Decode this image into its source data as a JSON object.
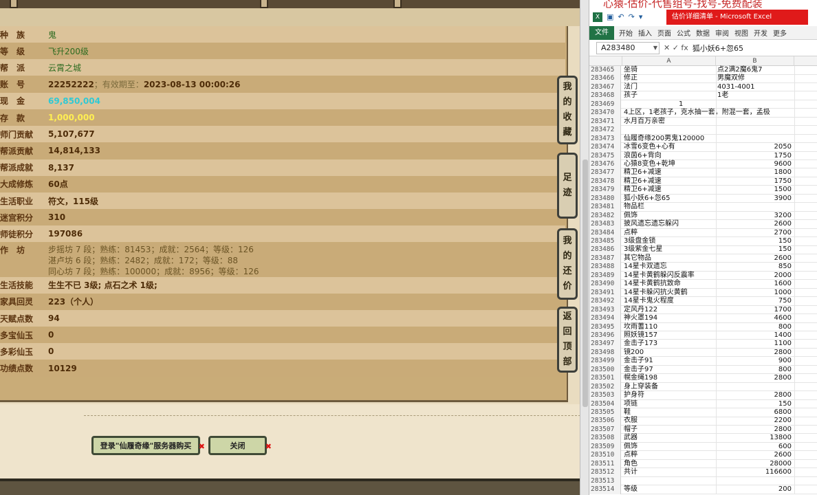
{
  "game": {
    "rows": [
      {
        "label": "种　族",
        "value": "鬼",
        "style": "green"
      },
      {
        "label": "等　级",
        "value": "飞升200级",
        "style": "green"
      },
      {
        "label": "帮　派",
        "value": "云霄之城",
        "style": "green"
      },
      {
        "label": "账　号",
        "value": "22252222",
        "sub": "；有效期至：",
        "value2": "2023-08-13 00:00:26",
        "style": "dark"
      },
      {
        "label": "现　金",
        "value": "69,850,004",
        "style": "cyan"
      },
      {
        "label": "存　款",
        "value": "1,000,000",
        "style": "yellow"
      },
      {
        "label": "师门贡献",
        "value": "5,107,677",
        "style": "dark"
      },
      {
        "label": "帮派贡献",
        "value": "14,814,133",
        "style": "dark"
      },
      {
        "label": "帮派成就",
        "value": "8,137",
        "style": "dark"
      },
      {
        "label": "大成修炼",
        "value": "60点",
        "style": "dark"
      },
      {
        "label": "生活职业",
        "value": "符文，115级",
        "style": "dark"
      },
      {
        "label": "迷宫积分",
        "value": "310",
        "style": "dark"
      },
      {
        "label": "师徒积分",
        "value": "197086",
        "style": "dark"
      }
    ],
    "workshop": {
      "label": "作　坊",
      "lines": [
        {
          "name": "步摇坊",
          "lv": "7",
          "skill": "81453",
          "achv": "2564",
          "grade": "126"
        },
        {
          "name": "湛卢坊",
          "lv": "6",
          "skill": "2482",
          "achv": "172",
          "grade": "88"
        },
        {
          "name": "同心坊",
          "lv": "7",
          "skill": "100000",
          "achv": "8956",
          "grade": "126"
        }
      ],
      "text_lines": [
        "步摇坊 7 段；熟练：81453；成就：2564；等级：126",
        "湛卢坊 6 段；熟练：2482；成就：172；等级：88",
        "同心坊 7 段；熟练：100000；成就：8956；等级：126"
      ]
    },
    "rows2": [
      {
        "label": "生活技能",
        "value": "生生不已 3级; 点石之术 1级;",
        "style": "dark"
      },
      {
        "label": "家具回灵",
        "value": "223（个人）",
        "style": "dark"
      },
      {
        "label": "天赋点数",
        "value": "94",
        "style": "dark"
      },
      {
        "label": "多宝仙玉",
        "value": "0",
        "style": "dark"
      },
      {
        "label": "多彩仙玉",
        "value": "0",
        "style": "dark"
      },
      {
        "label": "功绩点数",
        "value": "10129",
        "style": "dark"
      }
    ],
    "side_buttons": [
      "我的收藏",
      "足迹",
      "我的还价",
      "返回顶部"
    ],
    "login_button": "登录\"仙履奇缘\"服务器购买",
    "close_button": "关闭"
  },
  "excel": {
    "banner": "心猿-估价-代售组号-找号-免费配装",
    "window_title": "估价详细清单 - Microsoft Excel",
    "ribbon_file": "文件",
    "ribbon_tabs": [
      "开始",
      "插入",
      "页面",
      "公式",
      "数据",
      "审阅",
      "视图",
      "开发",
      "更多"
    ],
    "name_box": "A283480",
    "formula": "狐小妖6+忽65",
    "col_a": "A",
    "col_b": "B",
    "rows": [
      {
        "n": "283465",
        "a": "坐骑",
        "b": "点2满2魔6鬼7",
        "num": false
      },
      {
        "n": "283466",
        "a": "修正",
        "b": "男魔双修",
        "num": false
      },
      {
        "n": "283467",
        "a": "法门",
        "b": "4031-4001",
        "num": false
      },
      {
        "n": "283468",
        "a": "孩子",
        "b": "1老",
        "num": false
      },
      {
        "n": "283469",
        "a": "",
        "b": "1",
        "num": false,
        "center": true
      },
      {
        "n": "283470",
        "a": "4上区，1老孩子，克水抽一套，附混一套，孟极",
        "b": "",
        "num": false
      },
      {
        "n": "283471",
        "a": "水月百万亲密",
        "b": "",
        "num": false
      },
      {
        "n": "283472",
        "a": "",
        "b": "",
        "num": false
      },
      {
        "n": "283473",
        "a": "仙履奇缘200男鬼120000",
        "b": "",
        "num": false
      },
      {
        "n": "283474",
        "a": "冰雪6变色+心有",
        "b": "2050",
        "num": true
      },
      {
        "n": "283475",
        "a": "浪茵6+背向",
        "b": "1750",
        "num": true
      },
      {
        "n": "283476",
        "a": "心猿8变色+乾坤",
        "b": "9600",
        "num": true
      },
      {
        "n": "283477",
        "a": "精卫6+减速",
        "b": "1800",
        "num": true
      },
      {
        "n": "283478",
        "a": "精卫6+减速",
        "b": "1750",
        "num": true
      },
      {
        "n": "283479",
        "a": "精卫6+减速",
        "b": "1500",
        "num": true
      },
      {
        "n": "283480",
        "a": "狐小妖6+忽65",
        "b": "3900",
        "num": true
      },
      {
        "n": "283481",
        "a": "物品栏",
        "b": "",
        "num": false
      },
      {
        "n": "283482",
        "a": "佩饰",
        "b": "3200",
        "num": true
      },
      {
        "n": "283483",
        "a": "披风遗忘遗忘躲闪",
        "b": "2600",
        "num": true
      },
      {
        "n": "283484",
        "a": "点粹",
        "b": "2700",
        "num": true
      },
      {
        "n": "283485",
        "a": "3级盘金锁",
        "b": "150",
        "num": true
      },
      {
        "n": "283486",
        "a": "3级紫金七星",
        "b": "150",
        "num": true
      },
      {
        "n": "283487",
        "a": "其它物品",
        "b": "2600",
        "num": true
      },
      {
        "n": "283488",
        "a": "14星卡双遗忘",
        "b": "850",
        "num": true
      },
      {
        "n": "283489",
        "a": "14星卡黄鹤躲闪反震率",
        "b": "2000",
        "num": true
      },
      {
        "n": "283490",
        "a": "14星卡黄鹤抗致命",
        "b": "1600",
        "num": true
      },
      {
        "n": "283491",
        "a": "14星卡躲闪抗火黄鹤",
        "b": "1000",
        "num": true
      },
      {
        "n": "283492",
        "a": "14星卡鬼火程度",
        "b": "750",
        "num": true
      },
      {
        "n": "283493",
        "a": "定风丹122",
        "b": "1700",
        "num": true
      },
      {
        "n": "283494",
        "a": "神火罩194",
        "b": "4600",
        "num": true
      },
      {
        "n": "283495",
        "a": "坎雨蓍110",
        "b": "800",
        "num": true
      },
      {
        "n": "283496",
        "a": "照妖镜157",
        "b": "1400",
        "num": true
      },
      {
        "n": "283497",
        "a": "金击子173",
        "b": "1100",
        "num": true
      },
      {
        "n": "283498",
        "a": "镜200",
        "b": "2800",
        "num": true
      },
      {
        "n": "283499",
        "a": "金击子91",
        "b": "900",
        "num": true
      },
      {
        "n": "283500",
        "a": "金击子97",
        "b": "800",
        "num": true
      },
      {
        "n": "283501",
        "a": "幌金绳198",
        "b": "2800",
        "num": true
      },
      {
        "n": "283502",
        "a": "身上穿装备",
        "b": "",
        "num": false
      },
      {
        "n": "283503",
        "a": "护身符",
        "b": "2800",
        "num": true
      },
      {
        "n": "283504",
        "a": "项链",
        "b": "150",
        "num": true
      },
      {
        "n": "283505",
        "a": "鞋",
        "b": "6800",
        "num": true
      },
      {
        "n": "283506",
        "a": "衣服",
        "b": "2200",
        "num": true
      },
      {
        "n": "283507",
        "a": "帽子",
        "b": "2800",
        "num": true
      },
      {
        "n": "283508",
        "a": "武器",
        "b": "13800",
        "num": true
      },
      {
        "n": "283509",
        "a": "佩饰",
        "b": "600",
        "num": true
      },
      {
        "n": "283510",
        "a": "点粹",
        "b": "2600",
        "num": true
      },
      {
        "n": "283511",
        "a": "角色",
        "b": "28000",
        "num": true
      },
      {
        "n": "283512",
        "a": "共计",
        "b": "116600",
        "num": true
      },
      {
        "n": "283513",
        "a": "",
        "b": "",
        "num": false
      },
      {
        "n": "283514",
        "a": "等级",
        "b": "200",
        "num": true
      }
    ]
  }
}
